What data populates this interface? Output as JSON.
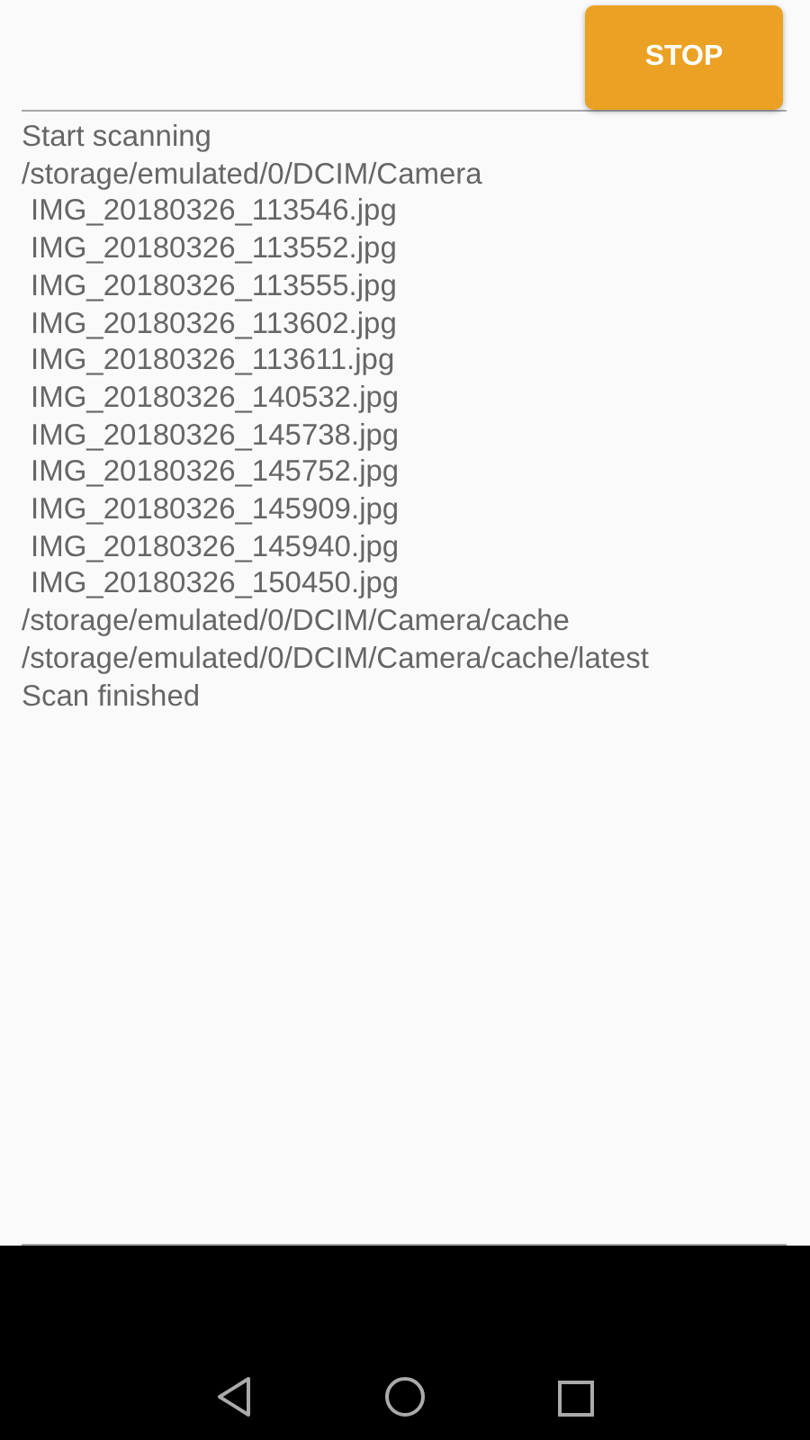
{
  "stop_button": {
    "label": "STOP"
  },
  "log": [
    {
      "kind": "message",
      "text": "Start scanning"
    },
    {
      "kind": "dir",
      "text": "/storage/emulated/0/DCIM/Camera"
    },
    {
      "kind": "file",
      "text": "IMG_20180326_113546.jpg"
    },
    {
      "kind": "file",
      "text": "IMG_20180326_113552.jpg"
    },
    {
      "kind": "file",
      "text": "IMG_20180326_113555.jpg"
    },
    {
      "kind": "file",
      "text": "IMG_20180326_113602.jpg"
    },
    {
      "kind": "file",
      "text": "IMG_20180326_113611.jpg"
    },
    {
      "kind": "file",
      "text": "IMG_20180326_140532.jpg"
    },
    {
      "kind": "file",
      "text": "IMG_20180326_145738.jpg"
    },
    {
      "kind": "file",
      "text": "IMG_20180326_145752.jpg"
    },
    {
      "kind": "file",
      "text": "IMG_20180326_145909.jpg"
    },
    {
      "kind": "file",
      "text": "IMG_20180326_145940.jpg"
    },
    {
      "kind": "file",
      "text": "IMG_20180326_150450.jpg"
    },
    {
      "kind": "dir",
      "text": "/storage/emulated/0/DCIM/Camera/cache"
    },
    {
      "kind": "dir",
      "text": "/storage/emulated/0/DCIM/Camera/cache/latest"
    },
    {
      "kind": "message",
      "text": "Scan finished"
    }
  ]
}
